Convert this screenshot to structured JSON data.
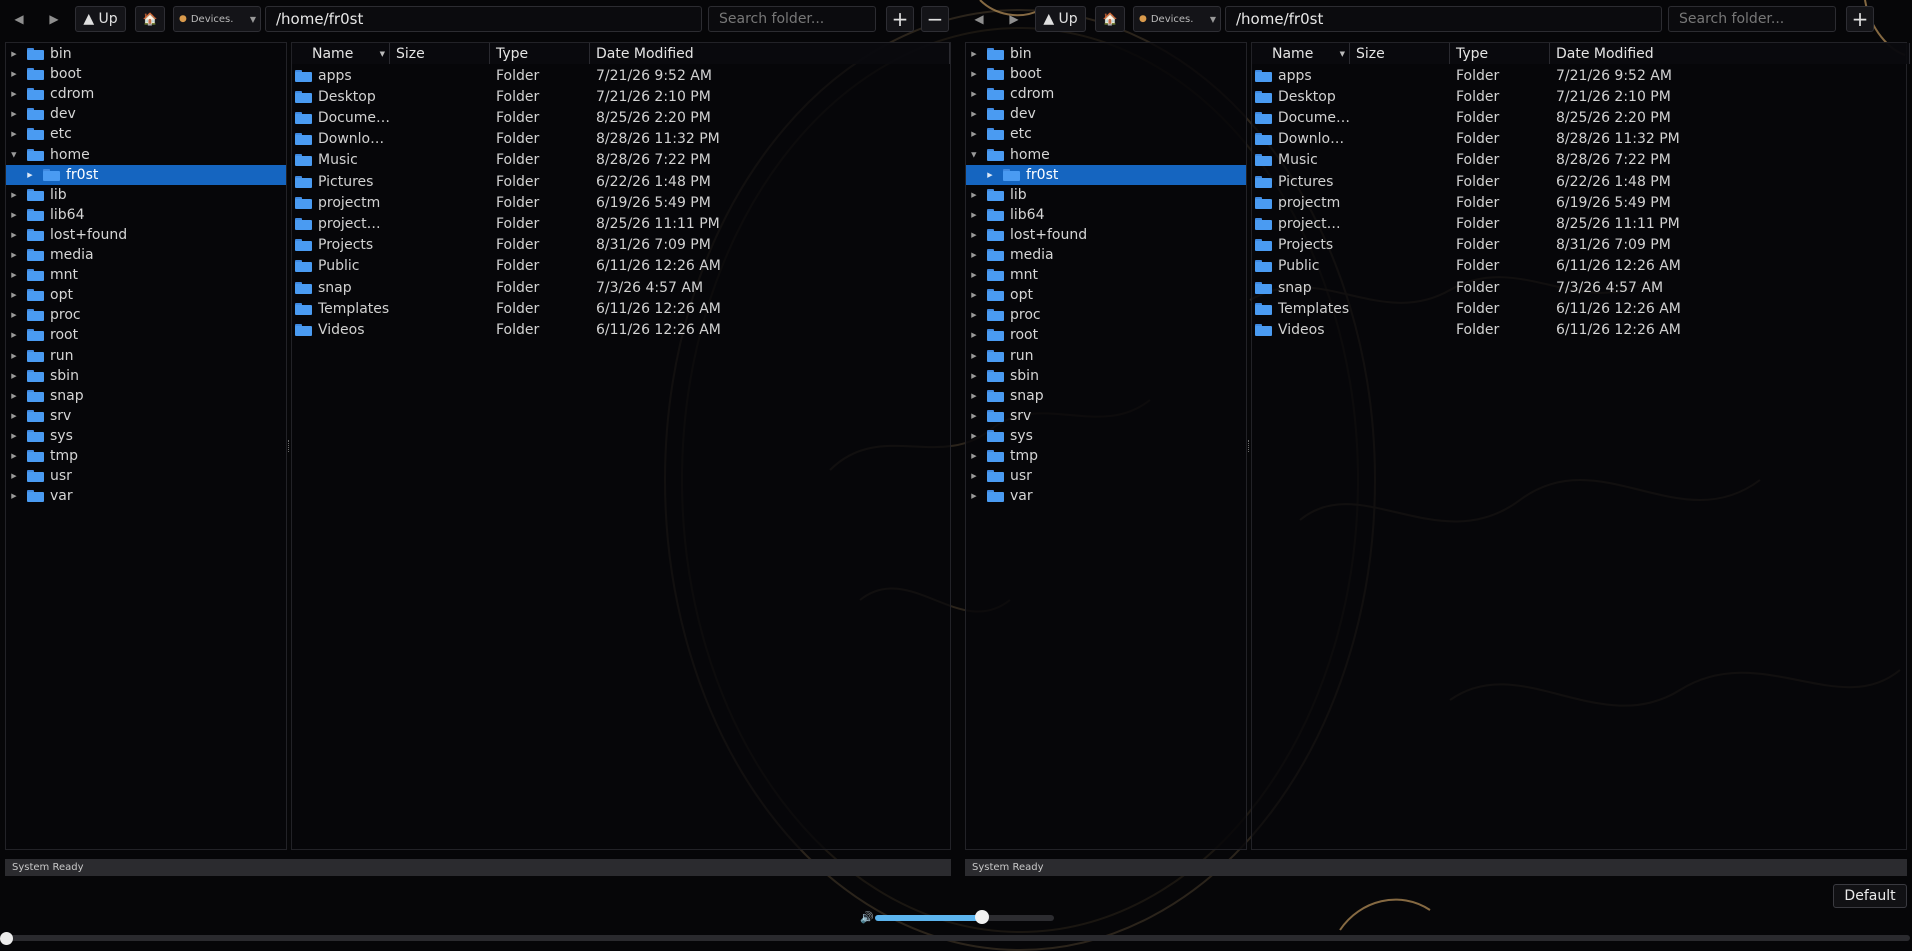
{
  "colors": {
    "accent": "#1565c0",
    "folder": "#4a9bf2",
    "volume_fill": "#5cb4ee"
  },
  "icons": {
    "back": "back-arrow-icon",
    "forward": "forward-arrow-icon",
    "up": "up-arrow-icon",
    "home": "home-icon",
    "drive": "drive-icon",
    "folder": "folder-icon",
    "volume": "speaker-icon"
  },
  "toolbar": {
    "back": "◀",
    "forward": "▶",
    "up_label": "▲ Up",
    "home": "🏠",
    "devices_label": "Devices.",
    "path": "/home/fr0st",
    "search_placeholder": "Search folder...",
    "add": "+",
    "remove": "−"
  },
  "tree": {
    "expanded": "home",
    "selected": "fr0st",
    "items": [
      {
        "label": "bin",
        "depth": 0,
        "state": "collapsed",
        "selected": false
      },
      {
        "label": "boot",
        "depth": 0,
        "state": "collapsed",
        "selected": false
      },
      {
        "label": "cdrom",
        "depth": 0,
        "state": "collapsed",
        "selected": false
      },
      {
        "label": "dev",
        "depth": 0,
        "state": "collapsed",
        "selected": false
      },
      {
        "label": "etc",
        "depth": 0,
        "state": "collapsed",
        "selected": false
      },
      {
        "label": "home",
        "depth": 0,
        "state": "expanded",
        "selected": false
      },
      {
        "label": "fr0st",
        "depth": 1,
        "state": "collapsed",
        "selected": true
      },
      {
        "label": "lib",
        "depth": 0,
        "state": "collapsed",
        "selected": false
      },
      {
        "label": "lib64",
        "depth": 0,
        "state": "collapsed",
        "selected": false
      },
      {
        "label": "lost+found",
        "depth": 0,
        "state": "collapsed",
        "selected": false
      },
      {
        "label": "media",
        "depth": 0,
        "state": "collapsed",
        "selected": false
      },
      {
        "label": "mnt",
        "depth": 0,
        "state": "collapsed",
        "selected": false
      },
      {
        "label": "opt",
        "depth": 0,
        "state": "collapsed",
        "selected": false
      },
      {
        "label": "proc",
        "depth": 0,
        "state": "collapsed",
        "selected": false
      },
      {
        "label": "root",
        "depth": 0,
        "state": "collapsed",
        "selected": false
      },
      {
        "label": "run",
        "depth": 0,
        "state": "collapsed",
        "selected": false
      },
      {
        "label": "sbin",
        "depth": 0,
        "state": "collapsed",
        "selected": false
      },
      {
        "label": "snap",
        "depth": 0,
        "state": "collapsed",
        "selected": false
      },
      {
        "label": "srv",
        "depth": 0,
        "state": "collapsed",
        "selected": false
      },
      {
        "label": "sys",
        "depth": 0,
        "state": "collapsed",
        "selected": false
      },
      {
        "label": "tmp",
        "depth": 0,
        "state": "collapsed",
        "selected": false
      },
      {
        "label": "usr",
        "depth": 0,
        "state": "collapsed",
        "selected": false
      },
      {
        "label": "var",
        "depth": 0,
        "state": "collapsed",
        "selected": false
      }
    ]
  },
  "columns": {
    "name": "Name",
    "size": "Size",
    "type": "Type",
    "date": "Date Modified",
    "sort_arrow": "▼"
  },
  "files": [
    {
      "name": "apps",
      "size": "",
      "type": "Folder",
      "date": "7/21/26 9:52 AM"
    },
    {
      "name": "Desktop",
      "size": "",
      "type": "Folder",
      "date": "7/21/26 2:10 PM"
    },
    {
      "name": "Docume…",
      "size": "",
      "type": "Folder",
      "date": "8/25/26 2:20 PM"
    },
    {
      "name": "Downlo…",
      "size": "",
      "type": "Folder",
      "date": "8/28/26 11:32 PM"
    },
    {
      "name": "Music",
      "size": "",
      "type": "Folder",
      "date": "8/28/26 7:22 PM"
    },
    {
      "name": "Pictures",
      "size": "",
      "type": "Folder",
      "date": "6/22/26 1:48 PM"
    },
    {
      "name": "projectm",
      "size": "",
      "type": "Folder",
      "date": "6/19/26 5:49 PM"
    },
    {
      "name": "project…",
      "size": "",
      "type": "Folder",
      "date": "8/25/26 11:11 PM"
    },
    {
      "name": "Projects",
      "size": "",
      "type": "Folder",
      "date": "8/31/26 7:09 PM"
    },
    {
      "name": "Public",
      "size": "",
      "type": "Folder",
      "date": "6/11/26 12:26 AM"
    },
    {
      "name": "snap",
      "size": "",
      "type": "Folder",
      "date": "7/3/26 4:57 AM"
    },
    {
      "name": "Templates",
      "size": "",
      "type": "Folder",
      "date": "6/11/26 12:26 AM"
    },
    {
      "name": "Videos",
      "size": "",
      "type": "Folder",
      "date": "6/11/26 12:26 AM"
    }
  ],
  "status": "System Ready",
  "volume": {
    "level": 0.6,
    "icon": "🔊"
  },
  "playback": {
    "position": 0.0
  },
  "preset_button": "Default"
}
